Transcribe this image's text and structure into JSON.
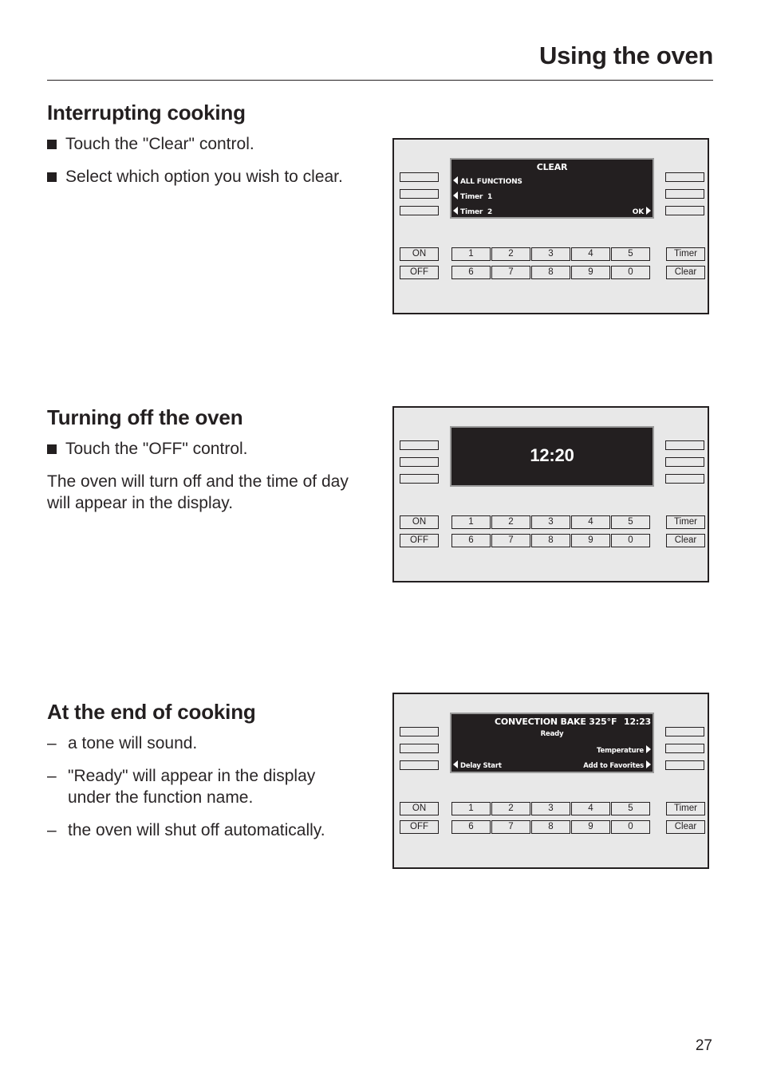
{
  "header": {
    "title": "Using the oven"
  },
  "sections": [
    {
      "heading": "Interrupting cooking",
      "bullets": [
        "Touch the \"Clear\" control.",
        "Select which option you wish to clear."
      ]
    },
    {
      "heading": "Turning off the oven",
      "bullets": [
        "Touch the \"OFF\" control."
      ],
      "paragraph": "The oven will turn off and the time of day will appear in the display."
    },
    {
      "heading": "At the end of cooking",
      "dash_marker": "–",
      "dashes": [
        "a tone will sound.",
        "\"Ready\" will appear in the display under the function name.",
        "the oven will shut off automatically."
      ]
    }
  ],
  "panels": [
    {
      "display": {
        "title": "CLEAR",
        "left_options": [
          "ALL FUNCTIONS",
          "Timer  1",
          "Timer  2"
        ],
        "right_options": [
          "OK"
        ]
      }
    },
    {
      "display": {
        "time": "12:20"
      }
    },
    {
      "display": {
        "function": "CONVECTION BAKE 325°F",
        "time": "12:23",
        "status": "Ready",
        "left_options": [
          "Delay Start"
        ],
        "right_options": [
          "Temperature",
          "Add to Favorites"
        ]
      }
    }
  ],
  "keypad": {
    "on": "ON",
    "off": "OFF",
    "row1": [
      "1",
      "2",
      "3",
      "4",
      "5"
    ],
    "row2": [
      "6",
      "7",
      "8",
      "9",
      "0"
    ],
    "timer": "Timer",
    "clear": "Clear"
  },
  "footer": {
    "page_number": "27"
  }
}
